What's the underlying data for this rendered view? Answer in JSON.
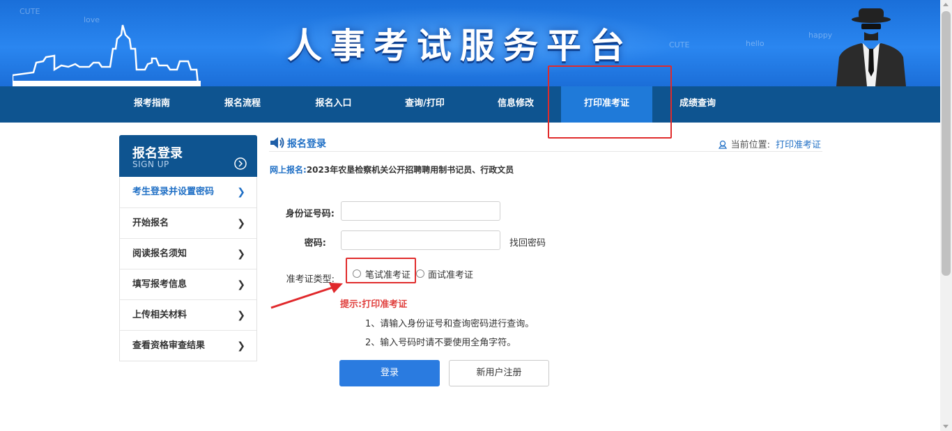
{
  "banner": {
    "title": "人事考试服务平台",
    "doodles": [
      "CUTE",
      "love",
      "CUTE",
      "hello",
      "happy"
    ]
  },
  "nav": {
    "items": [
      {
        "label": "报考指南"
      },
      {
        "label": "报名流程"
      },
      {
        "label": "报名入口"
      },
      {
        "label": "查询/打印"
      },
      {
        "label": "信息修改"
      },
      {
        "label": "打印准考证",
        "active": true
      },
      {
        "label": "成绩查询"
      }
    ]
  },
  "sidebar": {
    "title": "报名登录",
    "subtitle": "SIGN UP",
    "items": [
      {
        "label": "考生登录并设置密码",
        "active": true
      },
      {
        "label": "开始报名"
      },
      {
        "label": "阅读报名须知"
      },
      {
        "label": "填写报考信息"
      },
      {
        "label": "上传相关材料"
      },
      {
        "label": "查看资格审查结果"
      }
    ]
  },
  "main": {
    "section_title": "报名登录",
    "location_label": "当前位置:",
    "location_value": "打印准考证",
    "online_label": "网上报名:",
    "online_value": "2023年农垦检察机关公开招聘聘用制书记员、行政文员",
    "id_label": "身份证号码:",
    "id_value": "",
    "password_label": "密码:",
    "password_value": "",
    "forgot_label": "找回密码",
    "type_label": "准考证类型:",
    "radio_written": "笔试准考证",
    "radio_interview": "面试准考证",
    "tip_title": "提示:打印准考证",
    "tips": [
      "1、请输入身份证号和查询密码进行查询。",
      "2、输入号码时请不要使用全角字符。"
    ],
    "login_button": "登录",
    "register_button": "新用户注册"
  },
  "colors": {
    "nav_bg": "#0e5490",
    "nav_active": "#1f7ad9",
    "accent": "#1f6fc5",
    "highlight_red": "#e02b2b",
    "tip_red": "#e0403e",
    "login_button": "#2a7be0"
  }
}
